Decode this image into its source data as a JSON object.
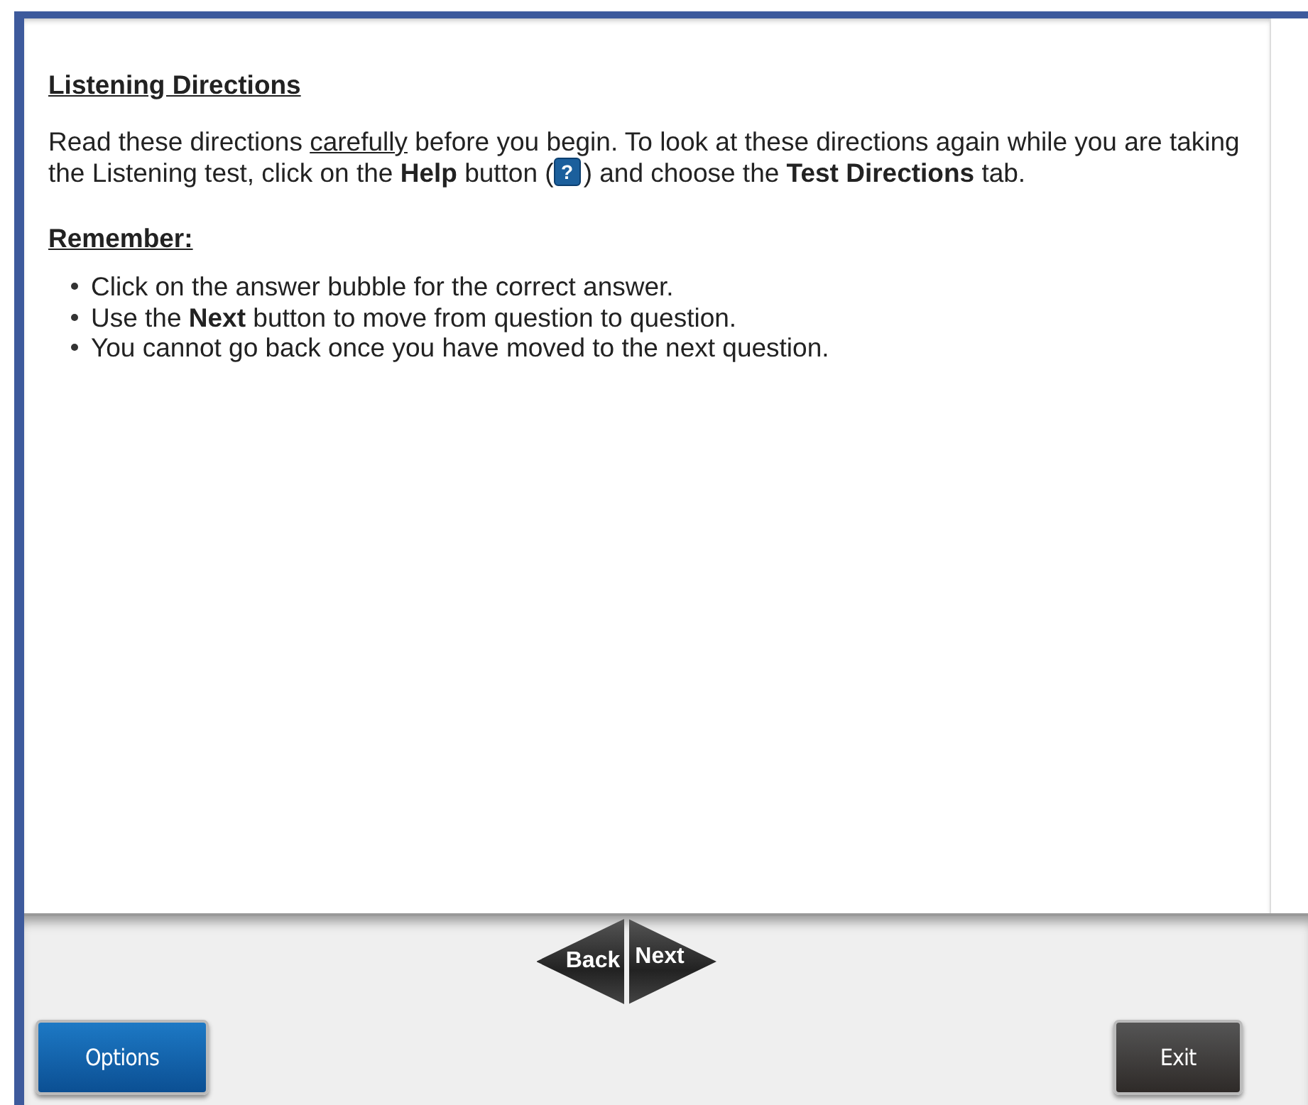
{
  "content": {
    "heading": "Listening Directions",
    "paragraph": [
      {
        "kind": "text",
        "text": "Read these directions "
      },
      {
        "kind": "underline",
        "text": "carefully"
      },
      {
        "kind": "text",
        "text": " before you begin. To look at these directions again while you are taking the Listening test, click on the "
      },
      {
        "kind": "bold",
        "text": "Help"
      },
      {
        "kind": "text",
        "text": " button ("
      },
      {
        "kind": "help-icon",
        "text": "?"
      },
      {
        "kind": "text",
        "text": ") and choose the "
      },
      {
        "kind": "bold",
        "text": "Test Directions"
      },
      {
        "kind": "text",
        "text": " tab."
      }
    ],
    "subheading": "Remember:",
    "bullets": [
      "Click on the answer bubble for the correct answer.",
      "Use the **Next** button to move from question to question.",
      "You cannot go back once you have moved to the next question."
    ]
  },
  "navigation": [
    {
      "kind": "back",
      "label": "Back"
    },
    {
      "kind": "next",
      "label": "Next"
    }
  ],
  "buttons": [
    {
      "kind": "options",
      "label": "Options"
    },
    {
      "kind": "exit",
      "label": "Exit"
    }
  ]
}
